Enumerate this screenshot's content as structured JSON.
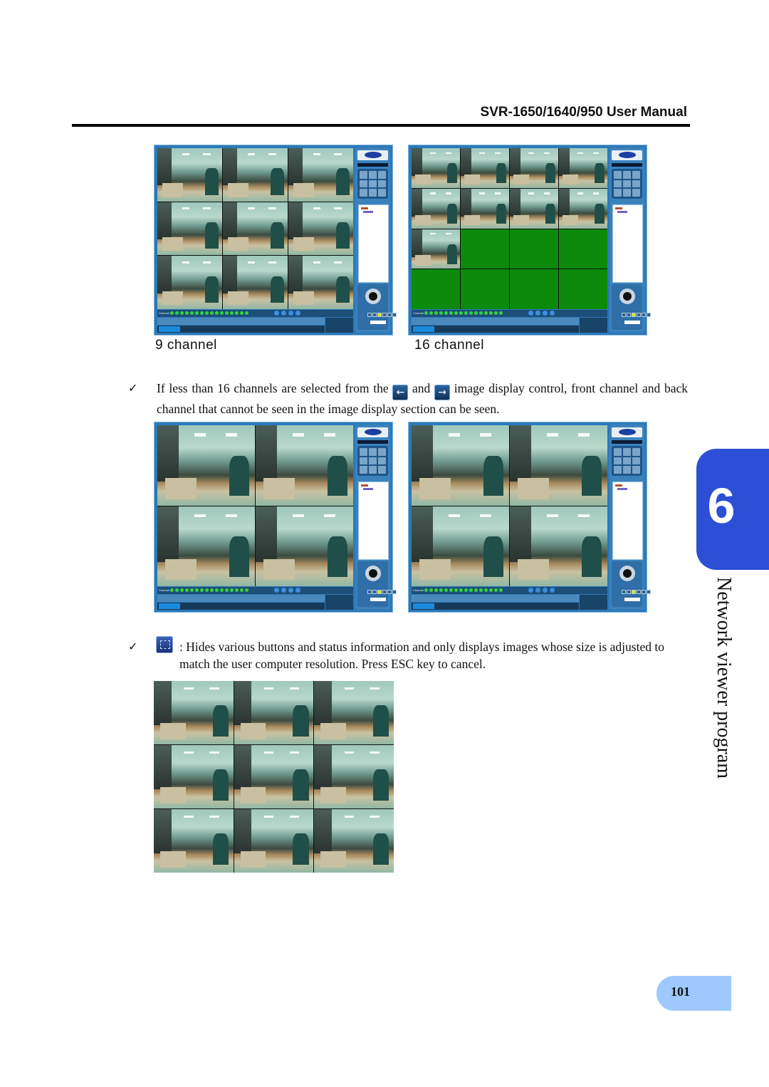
{
  "header": {
    "title": "SVR-1650/1640/950 User Manual"
  },
  "screenshots": {
    "nine_channel": {
      "caption": "9 channel",
      "layout": "3x3",
      "active_feeds": 9,
      "empty_feeds": 0
    },
    "sixteen_channel": {
      "caption": "16 channel",
      "layout": "4x4",
      "active_feeds": 9,
      "empty_feeds": 7,
      "empty_color": "#0b8a0b"
    },
    "four_channel_front": {
      "layout": "2x2",
      "active_feeds": 4
    },
    "four_channel_back": {
      "layout": "2x2",
      "active_feeds": 4
    },
    "fullscreen": {
      "layout": "3x3",
      "active_feeds": 9
    }
  },
  "viewer_ui": {
    "brand": "SAMSUNG",
    "channel_label": "Channel",
    "relay_label": "Relay",
    "speed_label": "Speed",
    "preset_label": "Preset",
    "channel_count": 16,
    "relay_count": 4,
    "speed_levels": 6,
    "speed_selected": 3
  },
  "body": {
    "bullet1": {
      "text_before": "If less than 16 channels are selected from the",
      "icon_left": "left-arrow-icon",
      "and": "and",
      "icon_right": "right-arrow-icon",
      "text_after": "image display control, front channel and back channel that cannot be seen in the image display section can be seen."
    },
    "bullet2": {
      "icon": "fullscreen-icon",
      "text": ": Hides various buttons and status information and only displays images whose size is adjusted to match the user computer resolution. Press ESC key to cancel."
    },
    "check_glyph": "✓",
    "left_arrow_glyph": "←",
    "right_arrow_glyph": "→"
  },
  "chapter": {
    "number": "6",
    "title": "Network viewer program",
    "tab_color": "#2c4fd6"
  },
  "footer": {
    "page_number": "101",
    "tab_color": "#9dc9ff"
  }
}
